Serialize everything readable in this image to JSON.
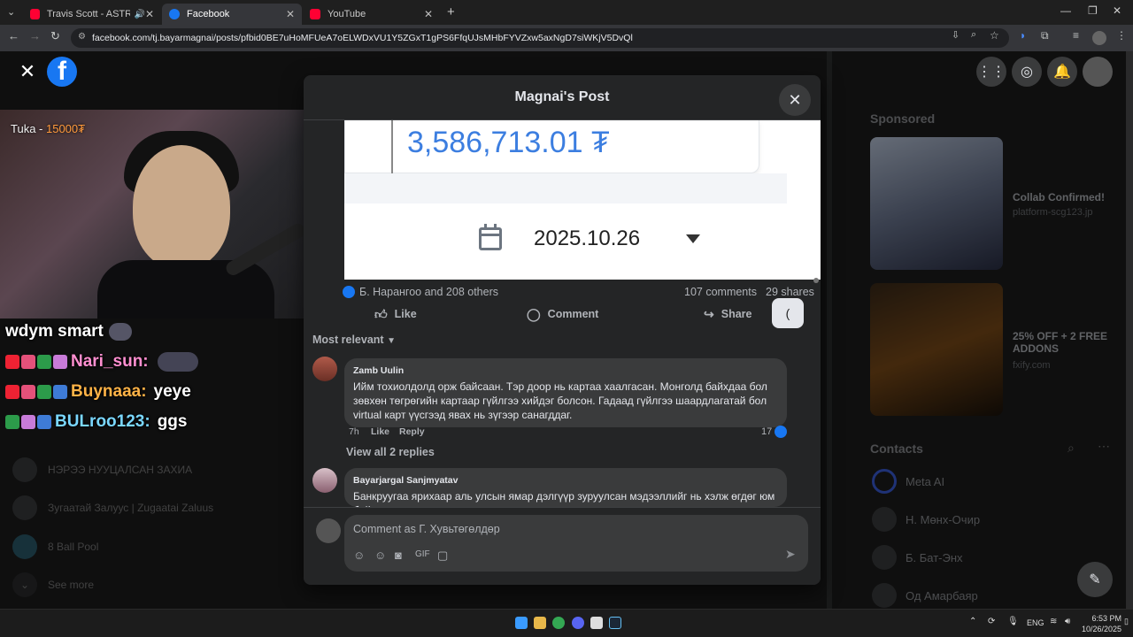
{
  "browser": {
    "tabs": [
      {
        "title": "Travis Scott - ASTROTHUN",
        "favicon_color": "#ff0033"
      },
      {
        "title": "Facebook",
        "favicon_color": "#1877f2"
      },
      {
        "title": "YouTube",
        "favicon_color": "#ff0033"
      }
    ],
    "url": "facebook.com/tj.bayarmagnai/posts/pfbid0BE7uHoMFUeA7oELWDxVU1Y5ZGxT1gPS6FfqUJsMHbFYVZxw5axNgD7siWKjV5DvQl"
  },
  "stream": {
    "cam_label_prefix": "Tuka - ",
    "cam_label_amount": "15000₮",
    "chat": [
      {
        "user": "",
        "message": "wdym smart",
        "user_color": "#ffffff"
      },
      {
        "user": "Nari_sun:",
        "message": "",
        "user_color": "#ff8fd0"
      },
      {
        "user": "Buynaaa:",
        "message": "yeye",
        "user_color": "#ffb347"
      },
      {
        "user": "BULroo123:",
        "message": "ggs",
        "user_color": "#7ad7ff"
      }
    ]
  },
  "sidebar_left": {
    "items": [
      {
        "label": "НЭРЭЭ НУУЦАЛСАН ЗАХИА"
      },
      {
        "label": "Зугаатай Залуус | Zugaatai Zaluus"
      },
      {
        "label": "8 Ball Pool"
      },
      {
        "label": "See more"
      }
    ]
  },
  "modal": {
    "title": "Magnai's Post",
    "image": {
      "amount": "3,586,713.01 ₮",
      "date": "2025.10.26"
    },
    "reactions_text": "Б. Нарангоо and 208 others",
    "comments_count": "107 comments",
    "shares_count": "29 shares",
    "actions": {
      "like": "Like",
      "comment": "Comment",
      "share": "Share"
    },
    "sort_label": "Most relevant",
    "comments": [
      {
        "name": "Zamb Uulin",
        "text": "Ийм тохиолдолд орж байсаан. Тэр доор нь картаа хаалгасан. Монголд байхдаа бол зөвхөн төгрөгийн картаар гүйлгээ хийдэг болсон. Гадаад гүйлгээ шаардлагатай бол virtual карт үүсгээд явах нь зүгээр санагддаг.",
        "time": "7h",
        "like": "Like",
        "reply": "Reply",
        "likes": "17"
      },
      {
        "name": "Bayarjargal Sanjmyatav",
        "text": "Банкруугаа ярихаар аль улсын ямар дэлгүүр зуруулсан мэдээллийг нь хэлж өгдөг юм байна лээ"
      }
    ],
    "view_replies": "View all 2 replies",
    "composer_placeholder": "Comment as Г. Хувьтөгөлдөр"
  },
  "sidebar_right": {
    "sponsored_heading": "Sponsored",
    "ads": [
      {
        "title": "Collab Confirmed!",
        "domain": "platform-scg123.jp"
      },
      {
        "title": "25% OFF + 2 FREE ADDONS",
        "domain": "fxify.com"
      }
    ],
    "contacts_heading": "Contacts",
    "contacts": [
      {
        "name": "Meta AI"
      },
      {
        "name": "Н. Мөнх-Очир"
      },
      {
        "name": "Б. Бат-Энх"
      },
      {
        "name": "Од Амарбаяр"
      }
    ]
  },
  "taskbar": {
    "lang": "ENG",
    "time": "6:53 PM",
    "date": "10/26/2025"
  }
}
